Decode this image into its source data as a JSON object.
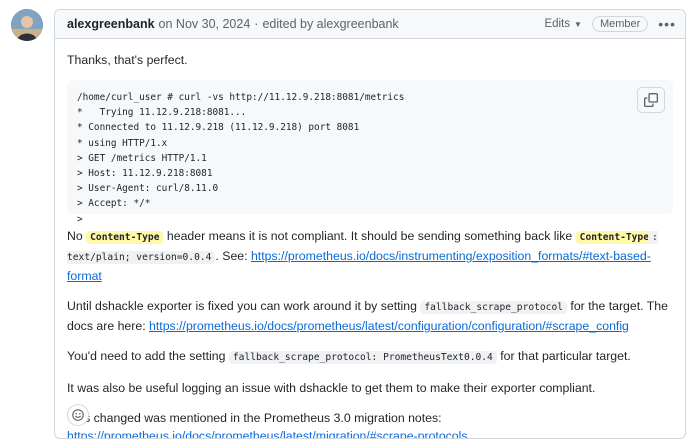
{
  "comment": {
    "author": "alexgreenbank",
    "date": "on Nov 30, 2024",
    "edited_separator": "·",
    "edited_by": "edited by alexgreenbank",
    "edits_label": "Edits",
    "role_badge": "Member",
    "menu_icon": "kebab-horizontal-icon",
    "intro": "Thanks, that's perfect.",
    "code_block": "/home/curl_user # curl -vs http://11.12.9.218:8081/metrics\n*   Trying 11.12.9.218:8081...\n* Connected to 11.12.9.218 (11.12.9.218) port 8081\n* using HTTP/1.x\n> GET /metrics HTTP/1.1\n> Host: 11.12.9.218:8081\n> User-Agent: curl/8.11.0\n> Accept: */*\n>",
    "copy_icon": "copy-icon",
    "para2": {
      "t1": "No",
      "c1": "Content-Type",
      "t2": "header means it is not compliant. It should be sending something back like",
      "c2": "Content-Type",
      "c3": ": text/plain; version=0.0.4",
      "t3": ". See:",
      "link": "https://prometheus.io/docs/instrumenting/exposition_formats/#text-based-format"
    },
    "para3": {
      "t1": "Until dshackle exporter is fixed you can work around it by setting",
      "c1": "fallback_scrape_protocol",
      "t2": "for the target. The docs are here:",
      "link": "https://prometheus.io/docs/prometheus/latest/configuration/configuration/#scrape_config"
    },
    "para4": {
      "t1": "You'd need to add the setting",
      "c1": "fallback_scrape_protocol: PrometheusText0.0.4",
      "t2": "for that particular target."
    },
    "para5": "It was also be useful logging an issue with dshackle to get them to make their exporter compliant.",
    "para6": {
      "t1": "This changed was mentioned in the Prometheus 3.0 migration notes:",
      "link": "https://prometheus.io/docs/prometheus/latest/migration/#scrape-protocols"
    },
    "reaction_icon": "smiley-icon"
  }
}
